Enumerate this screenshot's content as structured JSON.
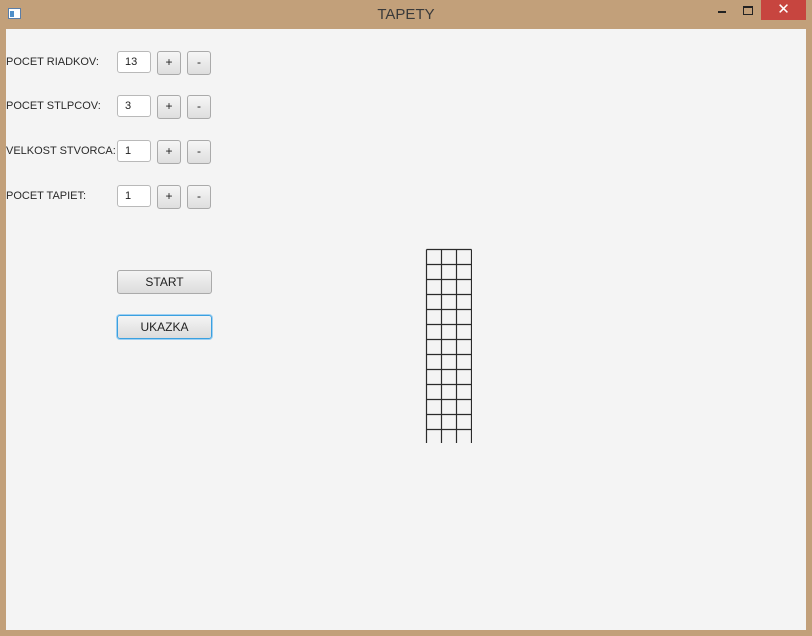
{
  "window": {
    "title": "TAPETY",
    "close_glyph": "✕",
    "icon": "app-window-icon"
  },
  "controls": [
    {
      "label": "POCET RIADKOV:",
      "value": "13",
      "plus": "+",
      "minus": "-"
    },
    {
      "label": "POCET STLPCOV:",
      "value": "3",
      "plus": "+",
      "minus": "-"
    },
    {
      "label": "VELKOST STVORCA:",
      "value": "1",
      "plus": "+",
      "minus": "-"
    },
    {
      "label": "POCET TAPIET:",
      "value": "1",
      "plus": "+",
      "minus": "-"
    }
  ],
  "buttons": {
    "start": "START",
    "ukazka": "UKAZKA"
  },
  "preview": {
    "rows": 13,
    "cols": 3,
    "line_color": "#2b2b2b"
  }
}
